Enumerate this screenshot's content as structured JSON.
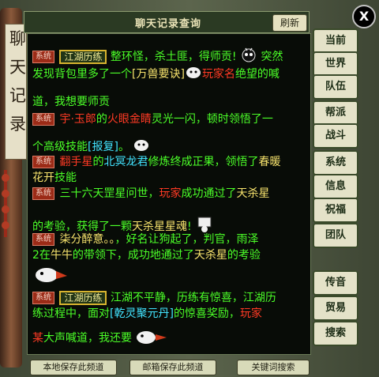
{
  "window": {
    "title": "聊天记录查询",
    "refresh_label": "刷新",
    "close_label": "X",
    "scroll_text": "聊天记录"
  },
  "messages": [
    {
      "tag": "系统",
      "rank": "江湖历练",
      "text1": "整环怪，杀土匪，得师贡!",
      "text2": "突然"
    },
    {
      "text1": "发现背包里多了一个",
      "item": "[万兽要诀]",
      "actor": "玩家名",
      "text2": "绝望的喊"
    },
    {
      "text1": "道，我想要师贡"
    },
    {
      "tag": "系统",
      "actor": "宇·玉郎",
      "text1": "的",
      "item": "火眼金睛",
      "text2": "灵光一闪，顿时领悟了一"
    },
    {
      "text1": "个高级技能",
      "item": "[报复]",
      "text2": "。"
    },
    {
      "tag": "系统",
      "actor": "翻手星",
      "text1": "的",
      "item": "北冥龙君",
      "text2": "修炼终成正果，领悟了",
      "item2": "春暖"
    },
    {
      "item": "花开",
      "text1": "技能"
    },
    {
      "tag": "系统",
      "text1": "三十六天罡星问世，",
      "actor": "玩家",
      "text2": "成功通过了",
      "item": "天杀星"
    },
    {
      "text1": "的考验，获得了一颗",
      "item": "天杀星星魂",
      "text2": "!"
    },
    {
      "tag": "系统",
      "text1": "柒分醉意。。",
      "text2": "，好名让狗起了，判官，",
      "text3": "雨泽"
    },
    {
      "text1": "2在",
      "item": "牛牛",
      "text2": "的带领下，成功地通过了",
      "item2": "天杀星",
      "text3": "的考验"
    },
    {
      "tag": "系统",
      "rank": "江湖历练",
      "text1": "江湖不平静，历练有惊喜，江湖历"
    },
    {
      "text1": "练过程中，面对",
      "item": "[乾灵聚元丹]",
      "text2": "的惊喜奖励，",
      "actor": "玩家"
    },
    {
      "actor": "某",
      "text1": "大声喊道，我还要"
    }
  ],
  "sidebar": [
    {
      "label": "当前"
    },
    {
      "label": "世界"
    },
    {
      "label": "队伍"
    },
    {
      "label": "帮派"
    },
    {
      "label": "战斗"
    },
    {
      "label": "系统"
    },
    {
      "label": "信息"
    },
    {
      "label": "祝福"
    },
    {
      "label": "团队"
    },
    {
      "label": "传音"
    },
    {
      "label": "贸易"
    },
    {
      "label": "搜索"
    }
  ],
  "bottom_buttons": {
    "save_local": "本地保存此频道",
    "save_mail": "邮箱保存此频道",
    "keyword_search": "关键词搜索"
  },
  "colors": {
    "system_tag": "#9b2b17",
    "green_text": "#4bff28",
    "yellow_text": "#f7e36d",
    "red_text": "#ff3a24",
    "cyan_text": "#42e4ff"
  },
  "icons": {
    "close": "close-icon",
    "scroll_up": "up-arrow-icon",
    "scroll_down": "down-arrow-icon"
  }
}
